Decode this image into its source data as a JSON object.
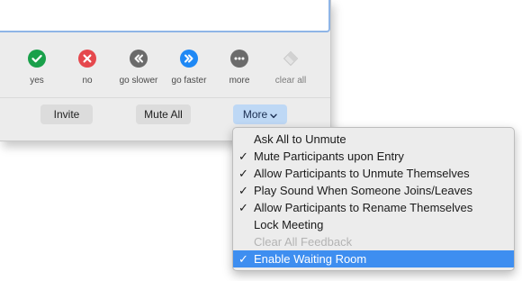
{
  "feedback": {
    "items": [
      {
        "label": "yes",
        "icon": "check-icon",
        "color": "#19a04a"
      },
      {
        "label": "no",
        "icon": "x-icon",
        "color": "#e5484d"
      },
      {
        "label": "go slower",
        "icon": "rewind-icon",
        "color": "#6b6b6b"
      },
      {
        "label": "go faster",
        "icon": "fast-forward-icon",
        "color": "#1e88f5"
      },
      {
        "label": "more",
        "icon": "ellipsis-icon",
        "color": "#6b6b6b"
      },
      {
        "label": "clear all",
        "icon": "eraser-icon",
        "color": "#c8c8c8"
      }
    ]
  },
  "buttons": {
    "invite": "Invite",
    "mute_all": "Mute All",
    "more": "More"
  },
  "menu": {
    "items": [
      {
        "label": "Ask All to Unmute",
        "checked": false,
        "disabled": false,
        "selected": false
      },
      {
        "label": "Mute Participants upon Entry",
        "checked": true,
        "disabled": false,
        "selected": false
      },
      {
        "label": "Allow Participants to Unmute Themselves",
        "checked": true,
        "disabled": false,
        "selected": false
      },
      {
        "label": "Play Sound When Someone Joins/Leaves",
        "checked": true,
        "disabled": false,
        "selected": false
      },
      {
        "label": "Allow Participants to Rename Themselves",
        "checked": true,
        "disabled": false,
        "selected": false
      },
      {
        "label": "Lock Meeting",
        "checked": false,
        "disabled": false,
        "selected": false
      },
      {
        "label": "Clear All Feedback",
        "checked": false,
        "disabled": true,
        "selected": false
      },
      {
        "label": "Enable Waiting Room",
        "checked": true,
        "disabled": false,
        "selected": true
      }
    ],
    "check_glyph": "✓"
  }
}
